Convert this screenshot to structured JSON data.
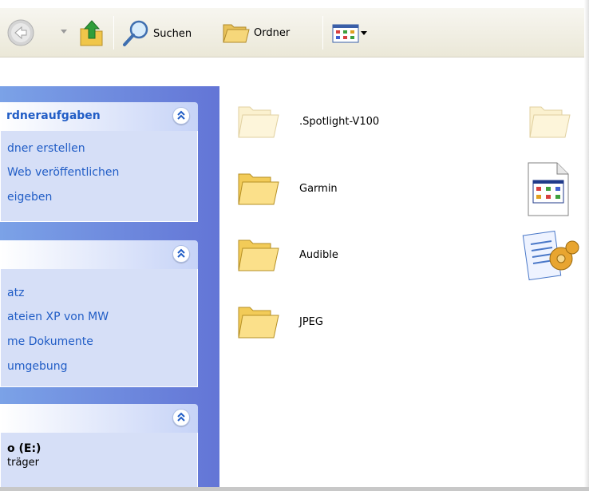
{
  "toolbar": {
    "search_label": "Suchen",
    "folders_label": "Ordner"
  },
  "taskpane": {
    "panel1": {
      "title": "rdneraufgaben",
      "links": [
        "dner erstellen",
        "Web veröffentlichen",
        "eigeben"
      ]
    },
    "panel2": {
      "links": [
        "atz",
        "ateien XP von MW",
        "me Dokumente",
        "umgebung"
      ]
    },
    "panel3": {
      "drive_title": "o (E:)",
      "drive_subtitle": "träger"
    }
  },
  "files": [
    {
      "name": ".Spotlight-V100",
      "type": "folder-faded"
    },
    {
      "name": "Garmin",
      "type": "folder"
    },
    {
      "name": "Audible",
      "type": "folder"
    },
    {
      "name": "JPEG",
      "type": "folder"
    }
  ],
  "icons": {
    "back": "back-arrow-icon",
    "up": "folder-up-icon",
    "search": "search-icon",
    "folders": "folders-icon",
    "views": "views-icon"
  },
  "colors": {
    "taskpane_gradient_start": "#7ba2e7",
    "taskpane_gradient_end": "#6375d6",
    "link_blue": "#215dc6",
    "panel_body": "#d6dff7",
    "folder_yellow": "#f9d867"
  }
}
